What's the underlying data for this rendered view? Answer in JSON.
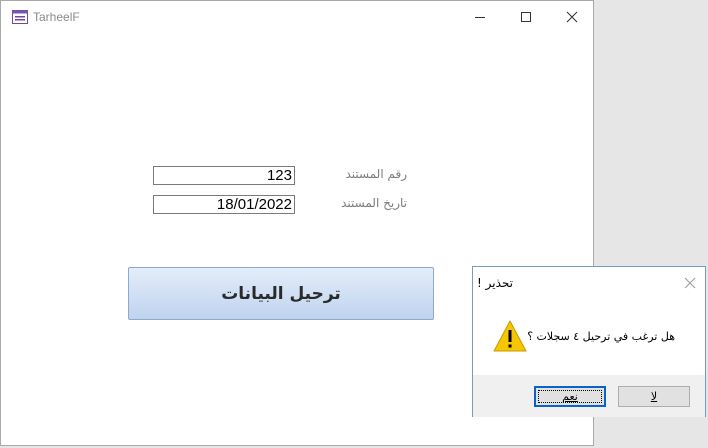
{
  "window": {
    "title": "TarheelF"
  },
  "form": {
    "doc_number_label": "رقم المستند",
    "doc_number_value": "123",
    "doc_date_label": "تاريخ المستند",
    "doc_date_value": "18/01/2022",
    "transfer_button": "ترحيل البيانات"
  },
  "dialog": {
    "title": "تحذير !",
    "message": "هل ترغب في ترحيل ٤ سجلات ؟",
    "yes_label": "نعم",
    "no_label": "لا",
    "icon": "warning-icon"
  },
  "colors": {
    "button_gradient_top": "#e4edf9",
    "button_gradient_bottom": "#bfd3ef",
    "warning_yellow": "#f6c600",
    "focus_blue": "#0a64c8"
  }
}
